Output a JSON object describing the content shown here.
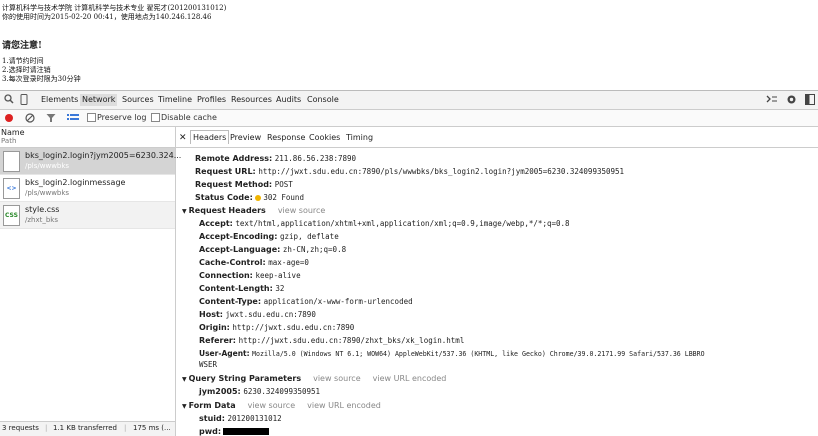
{
  "page": {
    "lines": [
      "计算机科学与技术学院 计算机科学与技术专业 翟宪才(201200131012)",
      "你的使用时间为2015-02-20 00:41，使用地点为140.246.128.46"
    ],
    "alert_title": "请您注意!",
    "alerts": [
      "1.请节约时间",
      "2.选择时请注销",
      "3.每次登录时限为30分钟"
    ]
  },
  "devtools": {
    "tabs": [
      "Elements",
      "Network",
      "Sources",
      "Timeline",
      "Profiles",
      "Resources",
      "Audits",
      "Console"
    ],
    "active_tab": "Network",
    "right_icons": [
      "terminal-icon",
      "gear-icon",
      "dock-icon"
    ],
    "toolbar": {
      "preserve_log": "Preserve log",
      "disable_cache": "Disable cache"
    },
    "columns": {
      "name": "Name",
      "path": "Path"
    },
    "requests": [
      {
        "name": "bks_login2.login?jym2005=6230.324...",
        "path": "/pls/wwwbks",
        "type": "doc"
      },
      {
        "name": "bks_login2.loginmessage",
        "path": "/pls/wwwbks",
        "type": "<>"
      },
      {
        "name": "style.css",
        "path": "/zhxt_bks",
        "type": "CSS"
      }
    ],
    "status_bar": [
      "3 requests",
      "1.1 KB transferred",
      "175 ms (..."
    ],
    "detail_tabs": [
      "Headers",
      "Preview",
      "Response",
      "Cookies",
      "Timing"
    ],
    "active_detail_tab": "Headers",
    "general": [
      {
        "k": "Remote Address:",
        "v": "211.86.56.238:7890"
      },
      {
        "k": "Request URL:",
        "v": "http://jwxt.sdu.edu.cn:7890/pls/wwwbks/bks_login2.login?jym2005=6230.324099350951"
      },
      {
        "k": "Request Method:",
        "v": "POST"
      },
      {
        "k": "Status Code:",
        "v": "302 Found"
      }
    ],
    "request_headers_title": "Request Headers",
    "view_source": "view source",
    "view_url_encoded": "view URL encoded",
    "request_headers": [
      {
        "k": "Accept:",
        "v": "text/html,application/xhtml+xml,application/xml;q=0.9,image/webp,*/*;q=0.8"
      },
      {
        "k": "Accept-Encoding:",
        "v": "gzip, deflate"
      },
      {
        "k": "Accept-Language:",
        "v": "zh-CN,zh;q=0.8"
      },
      {
        "k": "Cache-Control:",
        "v": "max-age=0"
      },
      {
        "k": "Connection:",
        "v": "keep-alive"
      },
      {
        "k": "Content-Length:",
        "v": "32"
      },
      {
        "k": "Content-Type:",
        "v": "application/x-www-form-urlencoded"
      },
      {
        "k": "Host:",
        "v": "jwxt.sdu.edu.cn:7890"
      },
      {
        "k": "Origin:",
        "v": "http://jwxt.sdu.edu.cn:7890"
      },
      {
        "k": "Referer:",
        "v": "http://jwxt.sdu.edu.cn:7890/zhxt_bks/xk_login.html"
      },
      {
        "k": "User-Agent:",
        "v": "Mozilla/5.0 (Windows NT 6.1; WOW64) AppleWebKit/537.36 (KHTML, like Gecko) Chrome/39.0.2171.99 Safari/537.36 LBBRO"
      },
      {
        "k": "",
        "v": "WSER"
      }
    ],
    "query_title": "Query String Parameters",
    "query_params": [
      {
        "k": "jym2005:",
        "v": "6230.324099350951"
      }
    ],
    "form_title": "Form Data",
    "form_data": [
      {
        "k": "stuid:",
        "v": "201200131012"
      },
      {
        "k": "pwd:",
        "v": ""
      }
    ]
  },
  "colors": {
    "selected_row": "#d4d4d4",
    "record_red": "#d22",
    "status_dot": "#f0b400"
  }
}
